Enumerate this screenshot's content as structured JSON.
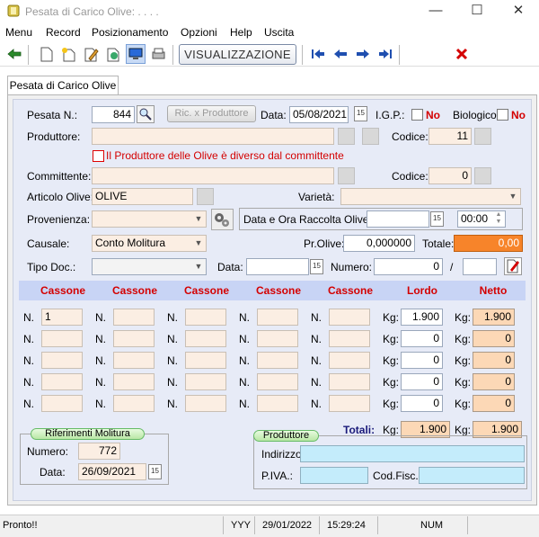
{
  "window": {
    "title": "Pesata di Carico Olive: . . . ."
  },
  "menu": [
    "Menu",
    "Record",
    "Posizionamento",
    "Opzioni",
    "Help",
    "Uscita"
  ],
  "toolbar": {
    "visualizzazione_label": "VISUALIZZAZIONE"
  },
  "tab": {
    "label": "Pesata di Carico Olive"
  },
  "form": {
    "pesata_label": "Pesata N.:",
    "pesata_value": "844",
    "ric_button": "Ric. x Produttore",
    "data_label": "Data:",
    "data_value": "05/08/2021",
    "igp_label": "I.G.P.:",
    "igp_value": "No",
    "bio_label": "Biologico:",
    "bio_value": "No",
    "produttore_label": "Produttore:",
    "produttore_value": "",
    "codice_label": "Codice:",
    "codice_prod_value": "11",
    "diverso_label": "Il Produttore delle Olive è diverso dal committente",
    "committente_label": "Committente:",
    "committente_value": "",
    "codice_comm_value": "0",
    "articolo_label": "Articolo Olive:",
    "articolo_value": "OLIVE",
    "varieta_label": "Varietà:",
    "varieta_value": "",
    "provenienza_label": "Provenienza:",
    "provenienza_value": "",
    "data_ora_label": "Data e Ora Raccolta Olive:",
    "data_raccolta_value": "",
    "ora_raccolta_value": "00:00",
    "causale_label": "Causale:",
    "causale_value": "Conto Molitura",
    "prolive_label": "Pr.Olive:",
    "prolive_value": "0,000000",
    "totale_label": "Totale:",
    "totale_value": "0,00",
    "tipodoc_label": "Tipo Doc.:",
    "tipodoc_value": "",
    "data2_label": "Data:",
    "data2_value": "",
    "numero_label": "Numero:",
    "numero_value": "0",
    "numero_sep": "/",
    "numero_suffix": ""
  },
  "grid": {
    "headers": [
      "Cassone",
      "Cassone",
      "Cassone",
      "Cassone",
      "Cassone",
      "Lordo",
      "Netto"
    ],
    "n_label": "N.",
    "kg_label": "Kg:",
    "rows": [
      {
        "cassoni": [
          "1",
          "",
          "",
          "",
          ""
        ],
        "lordo": "1.900",
        "netto": "1.900"
      },
      {
        "cassoni": [
          "",
          "",
          "",
          "",
          ""
        ],
        "lordo": "0",
        "netto": "0"
      },
      {
        "cassoni": [
          "",
          "",
          "",
          "",
          ""
        ],
        "lordo": "0",
        "netto": "0"
      },
      {
        "cassoni": [
          "",
          "",
          "",
          "",
          ""
        ],
        "lordo": "0",
        "netto": "0"
      },
      {
        "cassoni": [
          "",
          "",
          "",
          "",
          ""
        ],
        "lordo": "0",
        "netto": "0"
      }
    ],
    "totali_label": "Totali:",
    "totali_lordo": "1.900",
    "totali_netto": "1.900"
  },
  "riferimenti": {
    "title": "Riferimenti Molitura",
    "numero_label": "Numero:",
    "numero_value": "772",
    "data_label": "Data:",
    "data_value": "26/09/2021"
  },
  "produttore_box": {
    "title": "Produttore",
    "indirizzo_label": "Indirizzo:",
    "indirizzo_value": "",
    "piva_label": "P.IVA.:",
    "piva_value": "",
    "codfisc_label": "Cod.Fisc.:",
    "codfisc_value": ""
  },
  "status": {
    "message": "Pronto!!",
    "yyy": "YYY",
    "date": "29/01/2022",
    "time": "15:29:24",
    "num": "NUM"
  },
  "colors": {
    "panel_bg": "#e7ebf7",
    "accent_red": "#d40000",
    "total_orange": "#f7842a",
    "netto_peach": "#fcd8b6",
    "cassone_pink": "#fbeee3",
    "produttore_cyan": "#c4ecfb"
  }
}
